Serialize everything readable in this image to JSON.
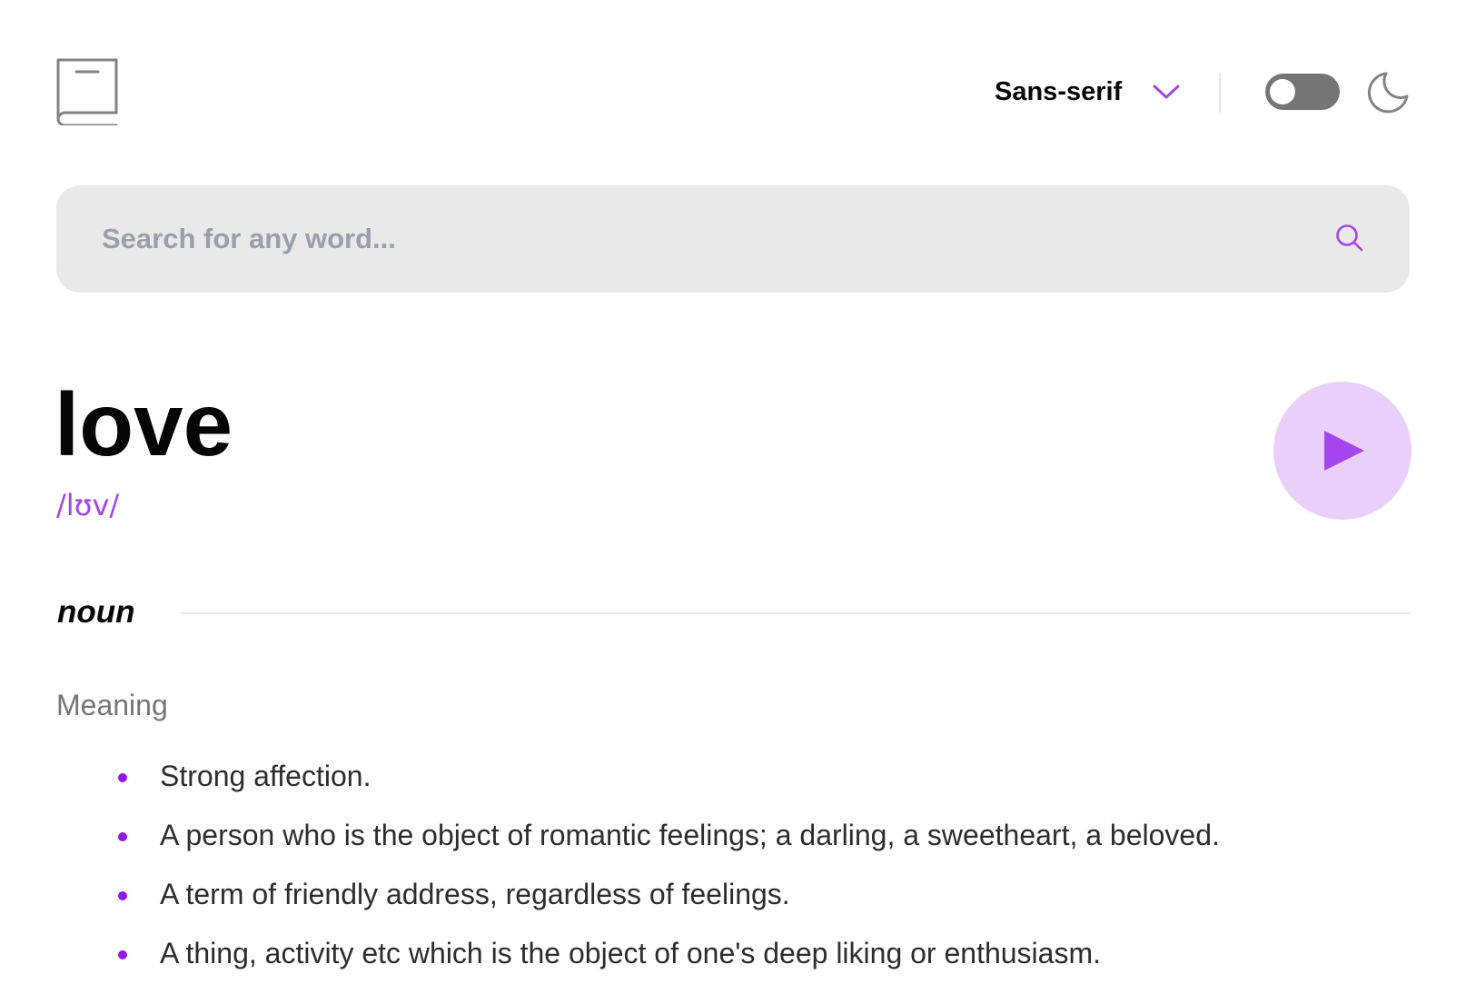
{
  "header": {
    "logo_icon": "book-icon",
    "font_selector": {
      "selected": "Sans-serif",
      "icon": "chevron-down-icon"
    },
    "theme_toggle": {
      "state": "off",
      "icon": "moon-icon"
    }
  },
  "search": {
    "placeholder": "Search for any word...",
    "value": "",
    "icon": "search-icon"
  },
  "entry": {
    "word": "love",
    "phonetic": "/lʊv/",
    "play_icon": "play-icon",
    "meanings": [
      {
        "part_of_speech": "noun",
        "label": "Meaning",
        "definitions": [
          "Strong affection.",
          "A person who is the object of romantic feelings; a darling, a sweetheart, a beloved.",
          "A term of friendly address, regardless of feelings.",
          "A thing, activity etc which is the object of one's deep liking or enthusiasm."
        ]
      }
    ]
  },
  "colors": {
    "accent": "#a445ed",
    "accent_light": "#e9d0fa",
    "search_bg": "#e9e9e9",
    "text_primary": "#050505",
    "text_secondary": "#757575",
    "toggle_bg": "#757575"
  }
}
